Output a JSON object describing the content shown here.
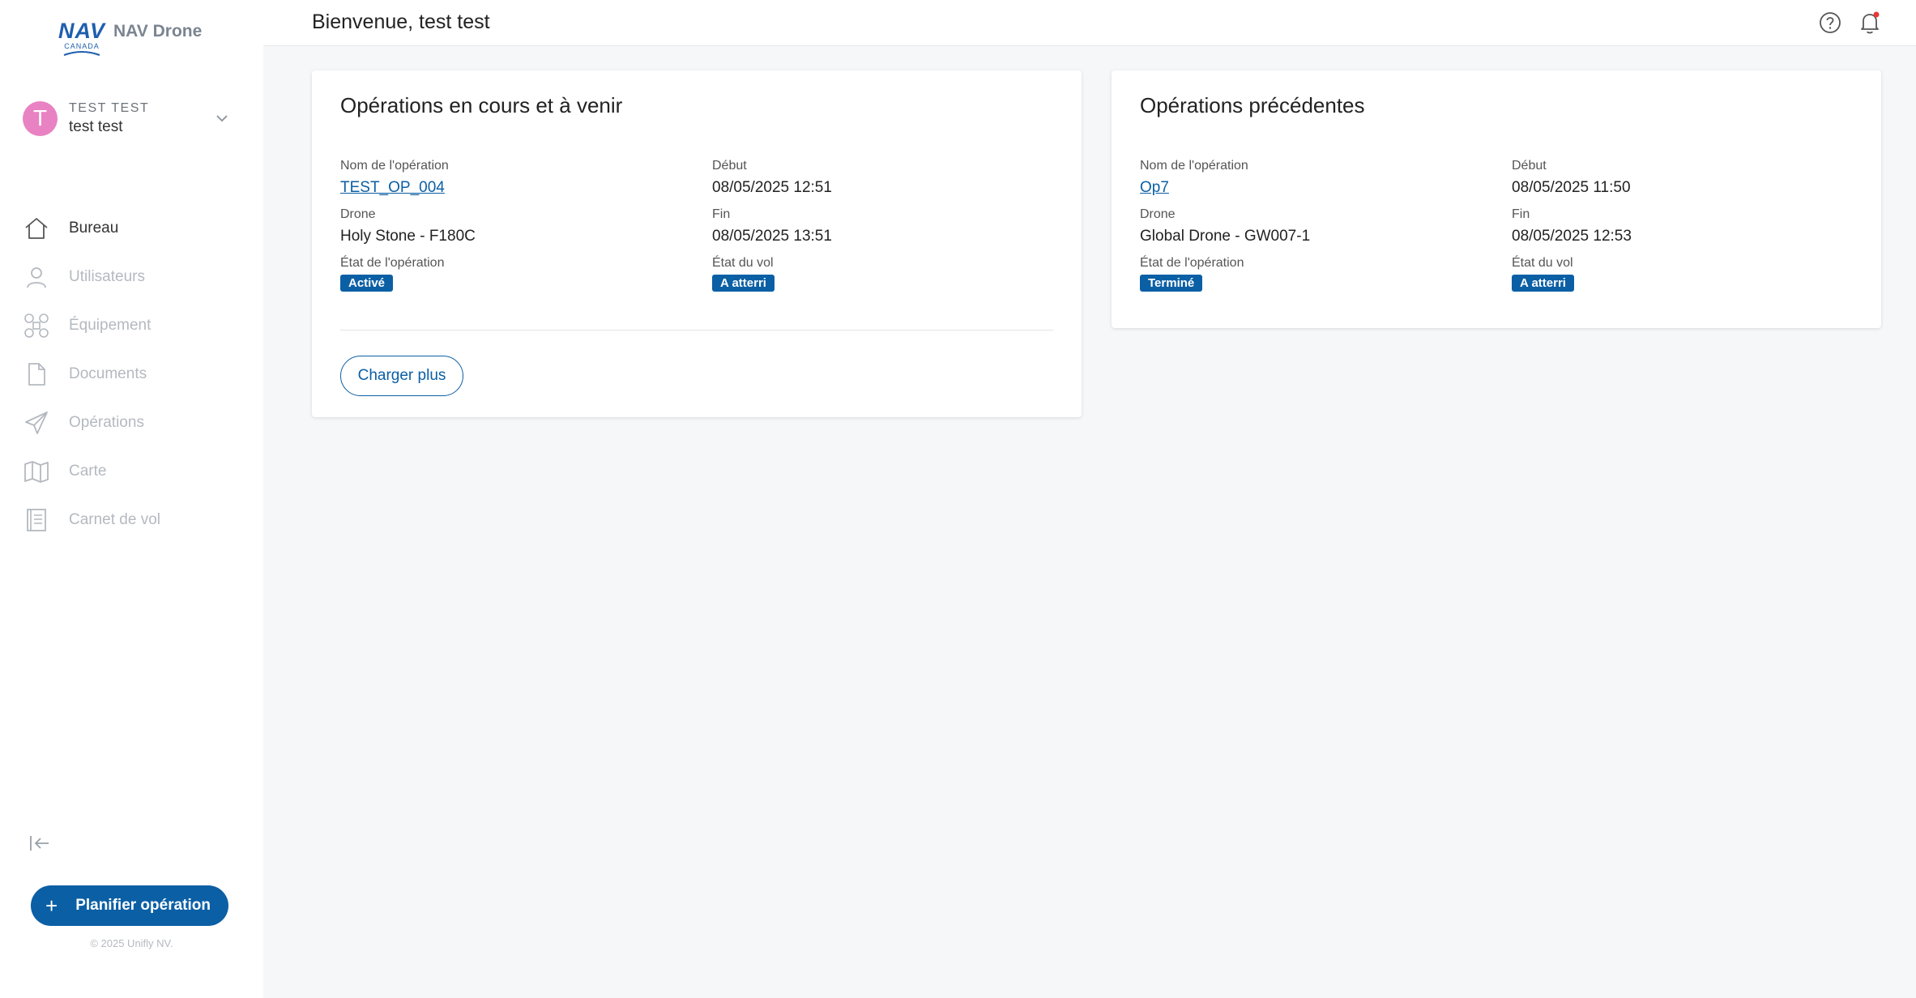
{
  "app": {
    "logo_brand": "NAV",
    "logo_country": "CANADA",
    "logo_app_name": "NAV Drone"
  },
  "user": {
    "initial": "T",
    "upper_name": "TEST TEST",
    "display_name": "test test",
    "avatar_color": "#e982c2"
  },
  "sidebar": {
    "items": [
      {
        "label": "Bureau",
        "icon": "home-icon",
        "active": true
      },
      {
        "label": "Utilisateurs",
        "icon": "user-icon",
        "active": false
      },
      {
        "label": "Équipement",
        "icon": "drone-icon",
        "active": false
      },
      {
        "label": "Documents",
        "icon": "document-icon",
        "active": false
      },
      {
        "label": "Opérations",
        "icon": "paper-plane-icon",
        "active": false
      },
      {
        "label": "Carte",
        "icon": "map-icon",
        "active": false
      },
      {
        "label": "Carnet de vol",
        "icon": "logbook-icon",
        "active": false
      }
    ],
    "plan_button": "Planifier opération",
    "plan_plus": "+",
    "copyright": "© 2025 Unifly NV."
  },
  "header": {
    "title": "Bienvenue, test test"
  },
  "current_ops": {
    "title": "Opérations en cours et à venir",
    "labels": {
      "name": "Nom de l'opération",
      "start": "Début",
      "drone": "Drone",
      "end": "Fin",
      "op_state": "État de l'opération",
      "flight_state": "État du vol"
    },
    "name": "TEST_OP_004",
    "start": "08/05/2025 12:51",
    "drone": "Holy Stone - F180C",
    "end": "08/05/2025 13:51",
    "op_state": "Activé",
    "flight_state": "A atterri",
    "load_more": "Charger plus"
  },
  "past_ops": {
    "title": "Opérations précédentes",
    "labels": {
      "name": "Nom de l'opération",
      "start": "Début",
      "drone": "Drone",
      "end": "Fin",
      "op_state": "État de l'opération",
      "flight_state": "État du vol"
    },
    "name": "Op7",
    "start": "08/05/2025 11:50",
    "drone": "Global Drone - GW007-1",
    "end": "08/05/2025 12:53",
    "op_state": "Terminé",
    "flight_state": "A atterri"
  },
  "colors": {
    "accent": "#0b5fa5",
    "logo_blue": "#1f5fae",
    "notification_dot": "#e53935"
  }
}
